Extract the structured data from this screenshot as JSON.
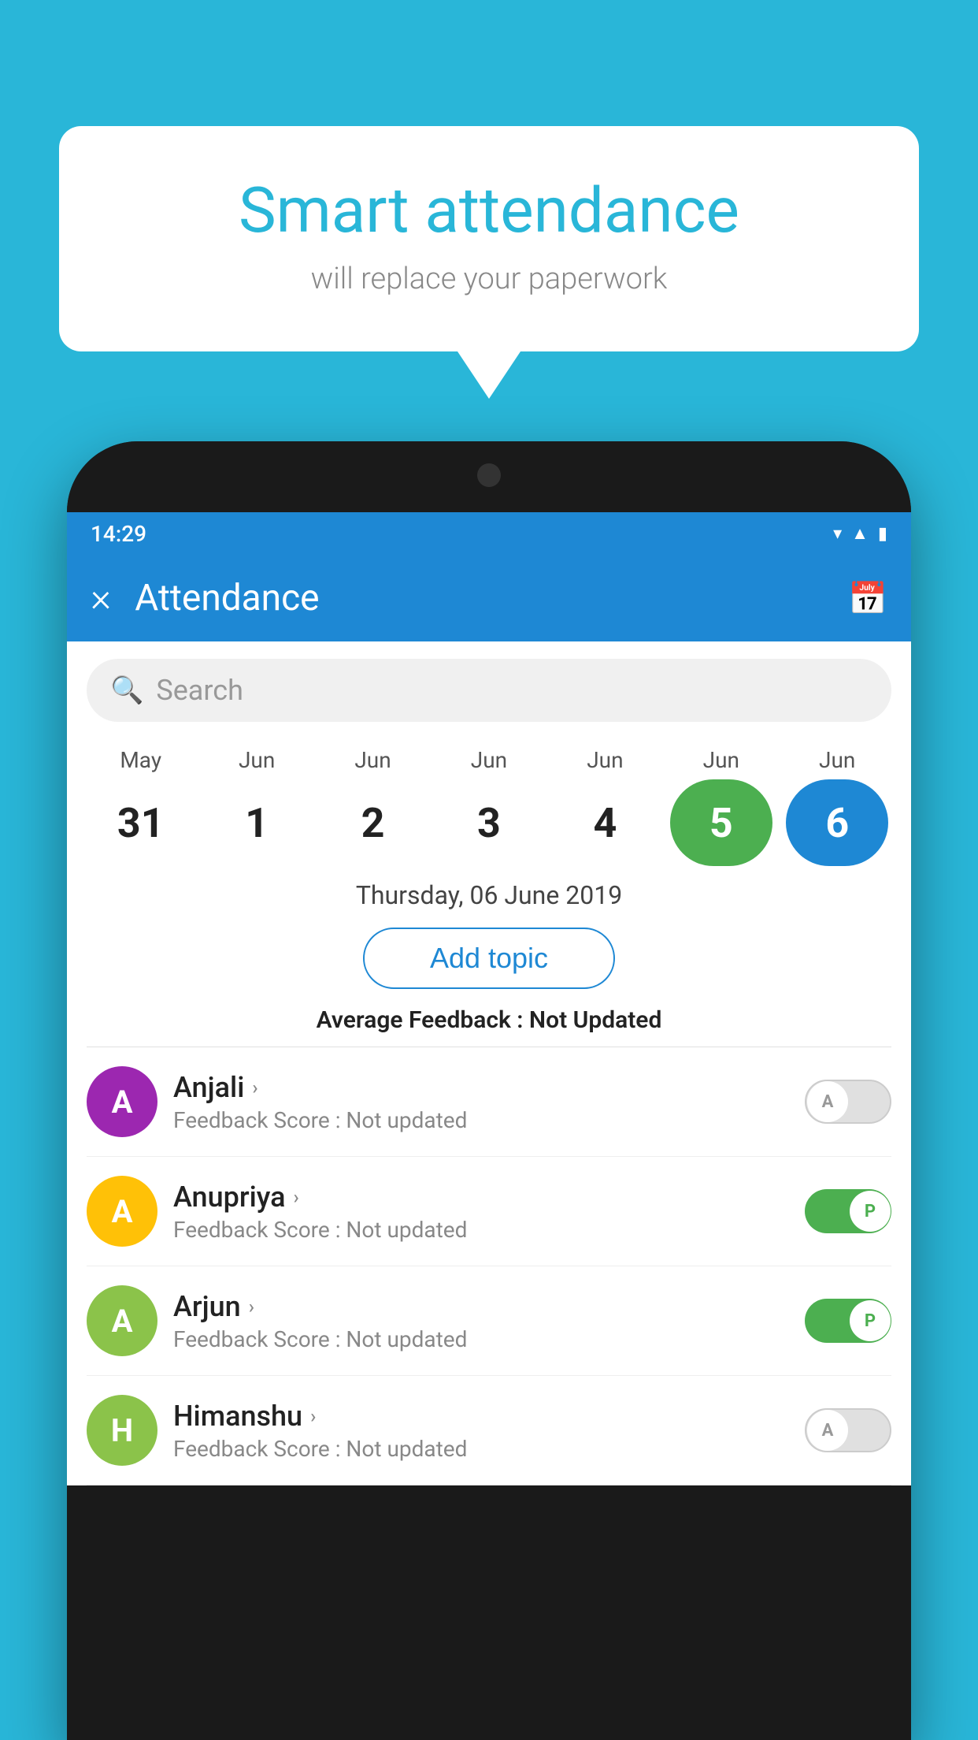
{
  "background_color": "#29b6d8",
  "speech_bubble": {
    "title": "Smart attendance",
    "subtitle": "will replace your paperwork"
  },
  "status_bar": {
    "time": "14:29",
    "icons": [
      "wifi",
      "signal",
      "battery"
    ]
  },
  "app_bar": {
    "title": "Attendance",
    "close_label": "×",
    "calendar_icon": "📅"
  },
  "search": {
    "placeholder": "Search"
  },
  "calendar": {
    "months": [
      "May",
      "Jun",
      "Jun",
      "Jun",
      "Jun",
      "Jun",
      "Jun"
    ],
    "days": [
      "31",
      "1",
      "2",
      "3",
      "4",
      "5",
      "6"
    ],
    "today_index": 5,
    "selected_index": 6
  },
  "selected_date": "Thursday, 06 June 2019",
  "add_topic_label": "Add topic",
  "avg_feedback": {
    "label": "Average Feedback : ",
    "value": "Not Updated"
  },
  "students": [
    {
      "name": "Anjali",
      "avatar_letter": "A",
      "avatar_color": "#9c27b0",
      "feedback": "Feedback Score : Not updated",
      "toggle_state": "off",
      "toggle_label": "A"
    },
    {
      "name": "Anupriya",
      "avatar_letter": "A",
      "avatar_color": "#ffc107",
      "feedback": "Feedback Score : Not updated",
      "toggle_state": "on",
      "toggle_label": "P"
    },
    {
      "name": "Arjun",
      "avatar_letter": "A",
      "avatar_color": "#8bc34a",
      "feedback": "Feedback Score : Not updated",
      "toggle_state": "on",
      "toggle_label": "P"
    },
    {
      "name": "Himanshu",
      "avatar_letter": "H",
      "avatar_color": "#8bc34a",
      "feedback": "Feedback Score : Not updated",
      "toggle_state": "off",
      "toggle_label": "A"
    }
  ]
}
